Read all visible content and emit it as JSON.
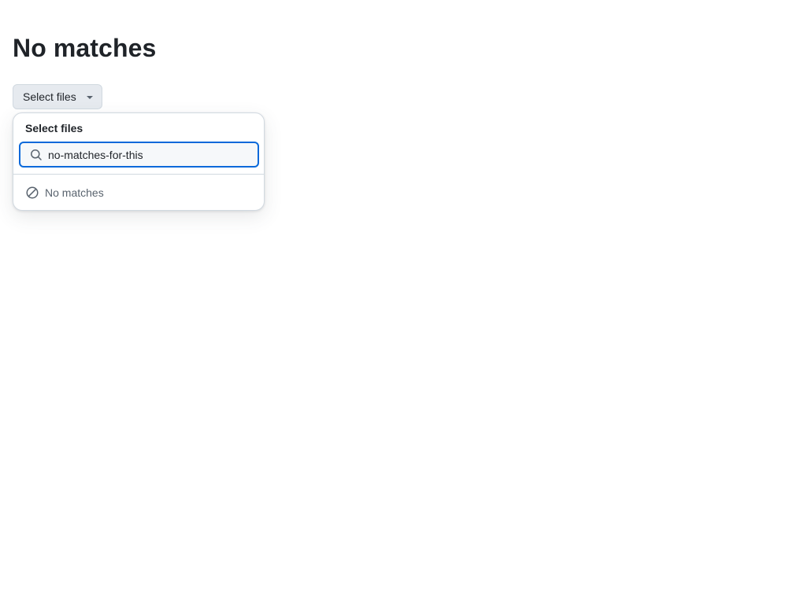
{
  "page": {
    "title": "No matches"
  },
  "select_button": {
    "label": "Select files",
    "icon": "triangle-down-icon"
  },
  "overlay": {
    "title": "Select files",
    "filter": {
      "value": "no-matches-for-this",
      "icon": "search-icon"
    },
    "empty_state": {
      "label": "No matches",
      "icon": "circle-slash-icon"
    }
  },
  "colors": {
    "accent": "#0969da",
    "text": "#1f2328",
    "muted": "#59636e",
    "border": "#d1d9e0"
  }
}
